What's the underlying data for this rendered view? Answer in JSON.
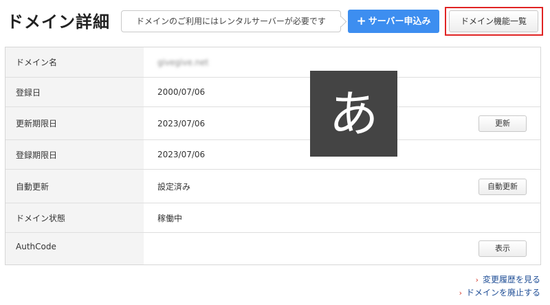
{
  "header": {
    "title": "ドメイン詳細",
    "notice": "ドメインのご利用にはレンタルサーバーが必要です",
    "server_button_label": "サーバー申込み",
    "functions_button_label": "ドメイン機能一覧"
  },
  "rows": [
    {
      "label": "ドメイン名",
      "value": "givegive.net",
      "button": null
    },
    {
      "label": "登録日",
      "value": "2000/07/06",
      "button": null
    },
    {
      "label": "更新期限日",
      "value": "2023/07/06",
      "button": "更新"
    },
    {
      "label": "登録期限日",
      "value": "2023/07/06",
      "button": null
    },
    {
      "label": "自動更新",
      "value": "設定済み",
      "button": "自動更新"
    },
    {
      "label": "ドメイン状態",
      "value": "稼働中",
      "button": null
    },
    {
      "label": "AuthCode",
      "value": "",
      "button": "表示"
    }
  ],
  "ime_indicator": {
    "char": "あ"
  },
  "links": {
    "history": "変更履歴を見る",
    "abolish": "ドメインを廃止する"
  },
  "colors": {
    "accent_blue": "#3d8ef0",
    "highlight_red": "#e02323",
    "link": "#1f4e96",
    "chevron": "#d33a2c"
  },
  "icons": {
    "plus": "plus-icon",
    "chevron": "chevron-right-icon"
  }
}
